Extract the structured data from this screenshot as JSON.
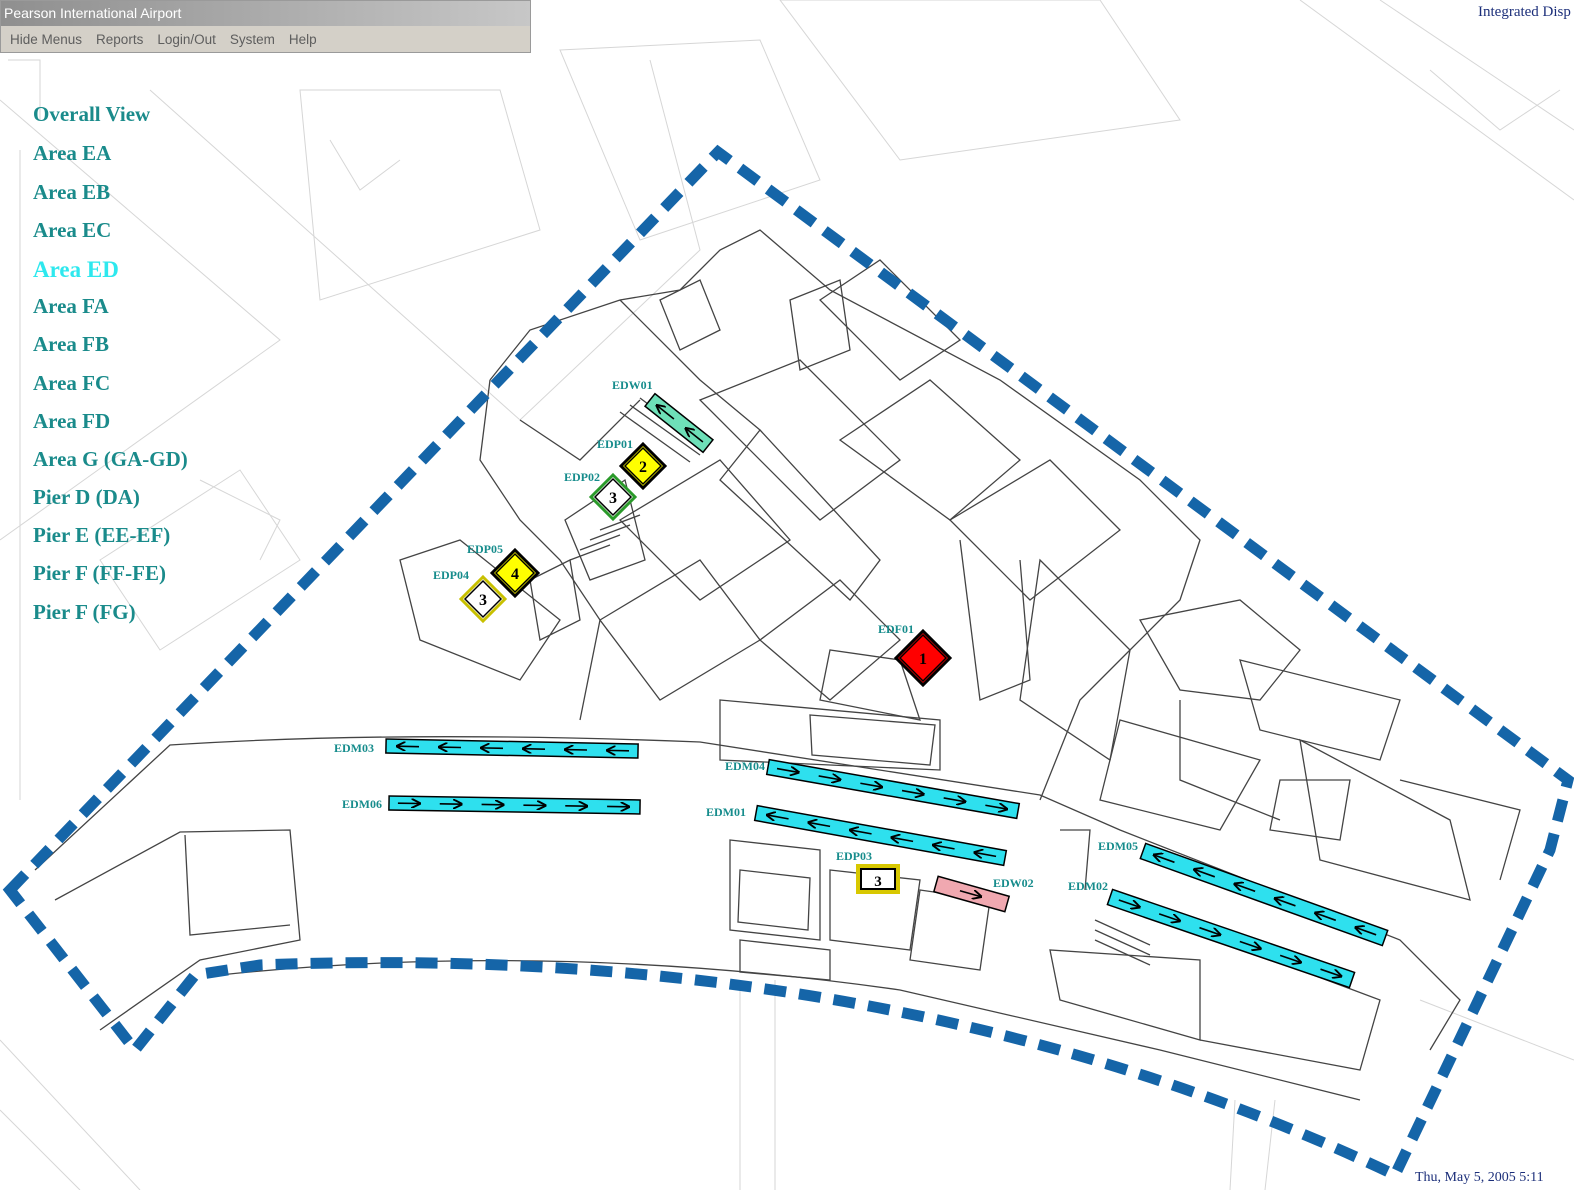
{
  "window": {
    "title": "Pearson International Airport",
    "menu": [
      "Hide Menus",
      "Reports",
      "Login/Out",
      "System",
      "Help"
    ]
  },
  "header_right": "Integrated Disp",
  "footer_datetime": "Thu, May 5, 2005   5:11",
  "nav": {
    "items": [
      {
        "label": "Overall View",
        "active": false
      },
      {
        "label": "Area EA",
        "active": false
      },
      {
        "label": "Area EB",
        "active": false
      },
      {
        "label": "Area EC",
        "active": false
      },
      {
        "label": "Area ED",
        "active": true
      },
      {
        "label": "Area FA",
        "active": false
      },
      {
        "label": "Area FB",
        "active": false
      },
      {
        "label": "Area FC",
        "active": false
      },
      {
        "label": "Area FD",
        "active": false
      },
      {
        "label": "Area G (GA-GD)",
        "active": false
      },
      {
        "label": "Pier D (DA)",
        "active": false
      },
      {
        "label": "Pier E (EE-EF)",
        "active": false
      },
      {
        "label": "Pier F (FF-FE)",
        "active": false
      },
      {
        "label": "Pier F (FG)",
        "active": false
      }
    ]
  },
  "colors": {
    "boundary": "#1565a8",
    "walkway": "#2ee0ee",
    "walkway_green": "#6ee0b8",
    "walkway_pink": "#f0a8b0",
    "status_red": "#ff0000",
    "status_yellow": "#ffff00",
    "status_white": "#ffffff",
    "label_teal": "#168c8c"
  },
  "map": {
    "devices": [
      {
        "id": "EDP01",
        "priority": "2",
        "status": "yellow"
      },
      {
        "id": "EDP02",
        "priority": "3",
        "status": "white-green"
      },
      {
        "id": "EDP05",
        "priority": "4",
        "status": "yellow"
      },
      {
        "id": "EDP04",
        "priority": "3",
        "status": "white-yellow"
      },
      {
        "id": "EDF01",
        "priority": "1",
        "status": "red"
      },
      {
        "id": "EDP03",
        "priority": "3",
        "status": "white-yellow"
      }
    ],
    "walkways": [
      {
        "id": "EDW01",
        "direction": "left",
        "color": "green"
      },
      {
        "id": "EDM03",
        "direction": "left",
        "color": "cyan"
      },
      {
        "id": "EDM06",
        "direction": "right",
        "color": "cyan"
      },
      {
        "id": "EDM04",
        "direction": "right",
        "color": "cyan"
      },
      {
        "id": "EDM01",
        "direction": "left",
        "color": "cyan"
      },
      {
        "id": "EDM05",
        "direction": "left",
        "color": "cyan"
      },
      {
        "id": "EDM02",
        "direction": "right",
        "color": "cyan"
      },
      {
        "id": "EDW02",
        "direction": "right",
        "color": "pink"
      }
    ]
  }
}
